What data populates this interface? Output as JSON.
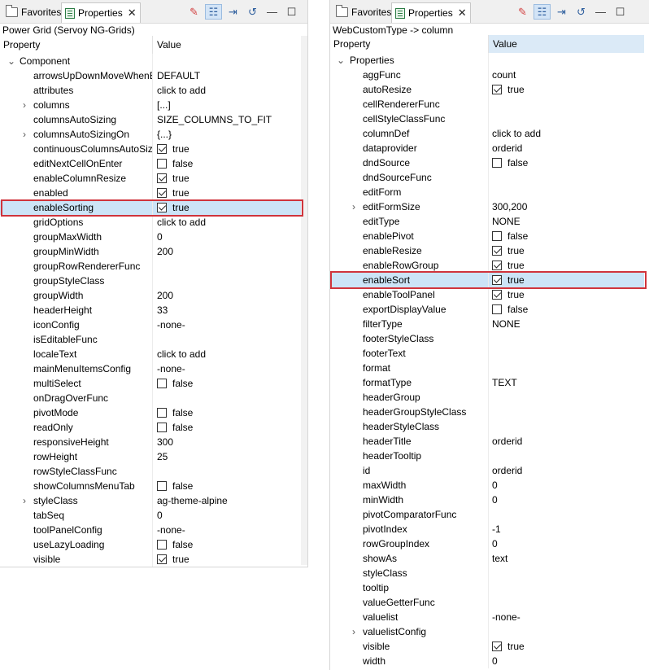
{
  "left": {
    "tabs": [
      {
        "label": "Favorites",
        "icon": "folder-icon"
      },
      {
        "label": "Properties",
        "icon": "properties-icon",
        "close": "✕"
      }
    ],
    "toolbar": [
      "pin-icon",
      "categories-icon",
      "filter-advanced-icon",
      "restore-default-icon",
      "minimize-icon",
      "maximize-icon"
    ],
    "title": "Power Grid (Servoy NG-Grids)",
    "col_property": "Property",
    "col_value": "Value",
    "group": "Component",
    "rows": [
      {
        "name": "arrowsUpDownMoveWhenEditing",
        "value": "DEFAULT"
      },
      {
        "name": "attributes",
        "value": "click to add"
      },
      {
        "name": "columns",
        "value": "[...]",
        "expandable": true
      },
      {
        "name": "columnsAutoSizing",
        "value": "SIZE_COLUMNS_TO_FIT"
      },
      {
        "name": "columnsAutoSizingOn",
        "value": "{...}",
        "expandable": true
      },
      {
        "name": "continuousColumnsAutoSizing",
        "value": "true",
        "checkbox": true,
        "checked": true
      },
      {
        "name": "editNextCellOnEnter",
        "value": "false",
        "checkbox": true,
        "checked": false
      },
      {
        "name": "enableColumnResize",
        "value": "true",
        "checkbox": true,
        "checked": true
      },
      {
        "name": "enabled",
        "value": "true",
        "checkbox": true,
        "checked": true
      },
      {
        "name": "enableSorting",
        "value": "true",
        "checkbox": true,
        "checked": true,
        "selected": true
      },
      {
        "name": "gridOptions",
        "value": "click to add"
      },
      {
        "name": "groupMaxWidth",
        "value": "0"
      },
      {
        "name": "groupMinWidth",
        "value": "200"
      },
      {
        "name": "groupRowRendererFunc",
        "value": ""
      },
      {
        "name": "groupStyleClass",
        "value": ""
      },
      {
        "name": "groupWidth",
        "value": "200"
      },
      {
        "name": "headerHeight",
        "value": "33"
      },
      {
        "name": "iconConfig",
        "value": "-none-"
      },
      {
        "name": "isEditableFunc",
        "value": ""
      },
      {
        "name": "localeText",
        "value": "click to add"
      },
      {
        "name": "mainMenuItemsConfig",
        "value": "-none-"
      },
      {
        "name": "multiSelect",
        "value": "false",
        "checkbox": true,
        "checked": false
      },
      {
        "name": "onDragOverFunc",
        "value": ""
      },
      {
        "name": "pivotMode",
        "value": "false",
        "checkbox": true,
        "checked": false
      },
      {
        "name": "readOnly",
        "value": "false",
        "checkbox": true,
        "checked": false
      },
      {
        "name": "responsiveHeight",
        "value": "300"
      },
      {
        "name": "rowHeight",
        "value": "25"
      },
      {
        "name": "rowStyleClassFunc",
        "value": ""
      },
      {
        "name": "showColumnsMenuTab",
        "value": "false",
        "checkbox": true,
        "checked": false
      },
      {
        "name": "styleClass",
        "value": "ag-theme-alpine",
        "expandable": true
      },
      {
        "name": "tabSeq",
        "value": "0"
      },
      {
        "name": "toolPanelConfig",
        "value": "-none-"
      },
      {
        "name": "useLazyLoading",
        "value": "false",
        "checkbox": true,
        "checked": false
      },
      {
        "name": "visible",
        "value": "true",
        "checkbox": true,
        "checked": true
      }
    ]
  },
  "right": {
    "tabs": [
      {
        "label": "Favorites",
        "icon": "folder-icon"
      },
      {
        "label": "Properties",
        "icon": "properties-icon",
        "close": "✕"
      }
    ],
    "toolbar": [
      "pin-icon",
      "categories-icon",
      "filter-advanced-icon",
      "restore-default-icon",
      "minimize-icon",
      "maximize-icon"
    ],
    "title": "WebCustomType -> column",
    "col_property": "Property",
    "col_value": "Value",
    "group": "Properties",
    "rows": [
      {
        "name": "aggFunc",
        "value": "count"
      },
      {
        "name": "autoResize",
        "value": "true",
        "checkbox": true,
        "checked": true
      },
      {
        "name": "cellRendererFunc",
        "value": ""
      },
      {
        "name": "cellStyleClassFunc",
        "value": ""
      },
      {
        "name": "columnDef",
        "value": "click to add"
      },
      {
        "name": "dataprovider",
        "value": "orderid"
      },
      {
        "name": "dndSource",
        "value": "false",
        "checkbox": true,
        "checked": false
      },
      {
        "name": "dndSourceFunc",
        "value": ""
      },
      {
        "name": "editForm",
        "value": ""
      },
      {
        "name": "editFormSize",
        "value": "300,200",
        "expandable": true
      },
      {
        "name": "editType",
        "value": "NONE"
      },
      {
        "name": "enablePivot",
        "value": "false",
        "checkbox": true,
        "checked": false
      },
      {
        "name": "enableResize",
        "value": "true",
        "checkbox": true,
        "checked": true
      },
      {
        "name": "enableRowGroup",
        "value": "true",
        "checkbox": true,
        "checked": true
      },
      {
        "name": "enableSort",
        "value": "true",
        "checkbox": true,
        "checked": true,
        "selected": true
      },
      {
        "name": "enableToolPanel",
        "value": "true",
        "checkbox": true,
        "checked": true
      },
      {
        "name": "exportDisplayValue",
        "value": "false",
        "checkbox": true,
        "checked": false
      },
      {
        "name": "filterType",
        "value": "NONE"
      },
      {
        "name": "footerStyleClass",
        "value": ""
      },
      {
        "name": "footerText",
        "value": ""
      },
      {
        "name": "format",
        "value": ""
      },
      {
        "name": "formatType",
        "value": "TEXT"
      },
      {
        "name": "headerGroup",
        "value": ""
      },
      {
        "name": "headerGroupStyleClass",
        "value": ""
      },
      {
        "name": "headerStyleClass",
        "value": ""
      },
      {
        "name": "headerTitle",
        "value": "orderid"
      },
      {
        "name": "headerTooltip",
        "value": ""
      },
      {
        "name": "id",
        "value": "orderid"
      },
      {
        "name": "maxWidth",
        "value": "0"
      },
      {
        "name": "minWidth",
        "value": "0"
      },
      {
        "name": "pivotComparatorFunc",
        "value": ""
      },
      {
        "name": "pivotIndex",
        "value": "-1"
      },
      {
        "name": "rowGroupIndex",
        "value": "0"
      },
      {
        "name": "showAs",
        "value": "text"
      },
      {
        "name": "styleClass",
        "value": ""
      },
      {
        "name": "tooltip",
        "value": ""
      },
      {
        "name": "valueGetterFunc",
        "value": ""
      },
      {
        "name": "valuelist",
        "value": "-none-"
      },
      {
        "name": "valuelistConfig",
        "value": "",
        "expandable": true
      },
      {
        "name": "visible",
        "value": "true",
        "checkbox": true,
        "checked": true
      },
      {
        "name": "width",
        "value": "0"
      }
    ]
  },
  "colors": {
    "selected_row": "#cce4f7",
    "highlight_border": "#d0343c",
    "header_value_bg": "#dbeaf7"
  }
}
